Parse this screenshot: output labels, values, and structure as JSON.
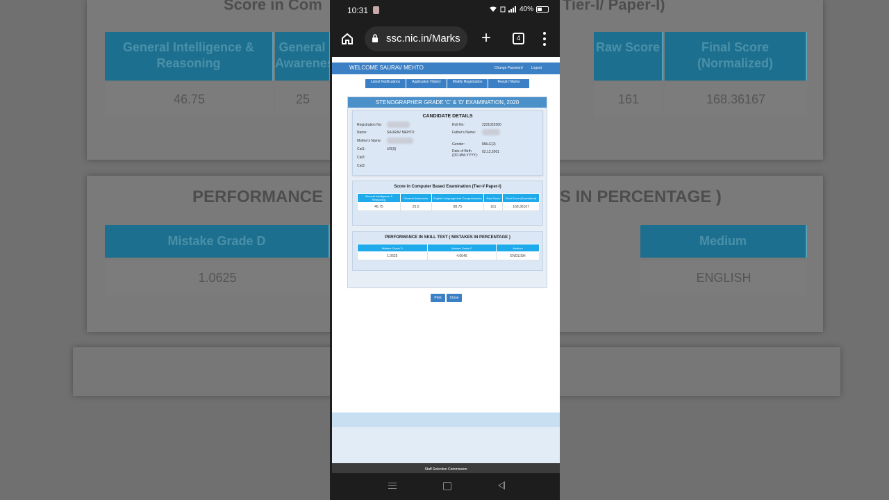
{
  "background": {
    "section1_title": "Score in Computer Based Examination (Tier-I/ Paper-I)",
    "section1_left": "Score in Com",
    "section1_right": "Tier-I/ Paper-I)",
    "section1_headers": [
      "General Intelligence & Reasoning",
      "General Awareness",
      "Raw Score",
      "Final Score (Normalized)"
    ],
    "section1_values": [
      "46.75",
      "25",
      "161",
      "168.36167"
    ],
    "section2_left": "PERFORMANCE",
    "section2_right": "S IN PERCENTAGE )",
    "section2_headers": [
      "Mistake Grade D",
      "Medium"
    ],
    "section2_values": [
      "1.0625",
      "ENGLISH"
    ]
  },
  "status_bar": {
    "time": "10:31",
    "signal_text": "40%"
  },
  "browser": {
    "url": "ssc.nic.in/Marks",
    "tab_count": "4"
  },
  "page": {
    "welcome": "WELCOME SAURAV MEHTO",
    "links": [
      "Change Password",
      "Logout"
    ],
    "nav_tabs": [
      "Latest Notifications",
      "Application History",
      "Modify Registration",
      "Result / Marks"
    ],
    "exam_title": "STENOGRAPHER GRADE 'C' & 'D' EXAMINATION, 2020",
    "candidate": {
      "title": "CANDIDATE DETAILS",
      "registration_label": "Registration No:",
      "roll_label": "Roll No:",
      "roll_value": "2201025560",
      "name_label": "Name:",
      "name_value": "SAURAV MEHTO",
      "father_label": "Father's Name:",
      "mother_label": "Mother's Name:",
      "gender_label": "Gender:",
      "gender_value": "MALE(2)",
      "cat1_label": "Cat1:",
      "cat1_value": "UR(9)",
      "dob_label": "Date of Birth",
      "dob_format": "(DD-MM-YYYY):",
      "dob_value": "02.12.2001",
      "cat2_label": "Cat2:",
      "cat3_label": "Cat3:"
    },
    "score": {
      "title": "Score in Computer Based Examination (Tier-I/ Paper-I)",
      "headers": [
        "General Intelligence & Reasoning",
        "General Awareness",
        "English Language And Comprehension",
        "Raw Score",
        "Final Score (Normalized)"
      ],
      "values": [
        "46.75",
        "25.5",
        "88.75",
        "161",
        "168.36167"
      ]
    },
    "performance": {
      "title": "PERFORMANCE IN SKILL TEST ( MISTAKES IN PERCENTAGE )",
      "headers": [
        "Mistake Grade D",
        "Mistake Grade C",
        "Medium"
      ],
      "values": [
        "1.0625",
        "4.6046",
        "ENGLISH"
      ]
    },
    "print_label": "Print",
    "close_label": "Close",
    "footer": "Staff Selection Commission"
  }
}
